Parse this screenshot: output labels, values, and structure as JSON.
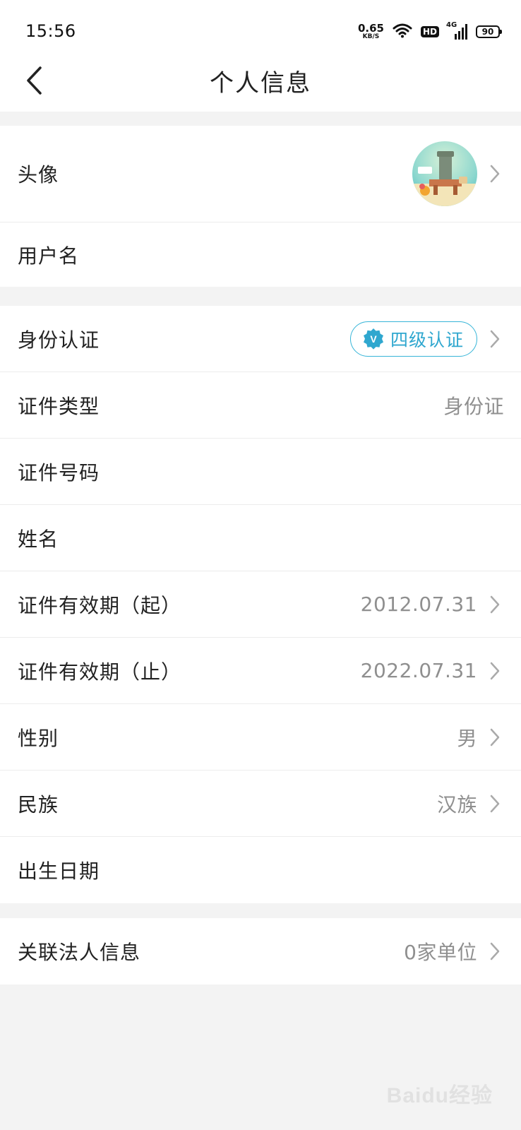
{
  "status_bar": {
    "time": "15:56",
    "net_speed_value": "0.65",
    "net_speed_unit": "KB/S",
    "hd_label": "HD",
    "signal_label": "4G",
    "battery_level": "90"
  },
  "header": {
    "title": "个人信息"
  },
  "group1": {
    "avatar_label": "头像",
    "username_label": "用户名"
  },
  "group2": {
    "identity_label": "身份认证",
    "identity_badge": "四级认证",
    "identity_badge_icon_letter": "V",
    "id_type_label": "证件类型",
    "id_type_value": "身份证",
    "id_number_label": "证件号码",
    "name_label": "姓名",
    "valid_from_label": "证件有效期（起）",
    "valid_from_value": "2012.07.31",
    "valid_to_label": "证件有效期（止）",
    "valid_to_value": "2022.07.31",
    "gender_label": "性别",
    "gender_value": "男",
    "ethnicity_label": "民族",
    "ethnicity_value": "汉族",
    "birthdate_label": "出生日期"
  },
  "group3": {
    "legal_label": "关联法人信息",
    "legal_value": "0家单位"
  },
  "watermark": "Baidu经验",
  "colors": {
    "accent": "#37b5d8",
    "background": "#f3f3f3",
    "value_gray": "#8f8f8f"
  }
}
